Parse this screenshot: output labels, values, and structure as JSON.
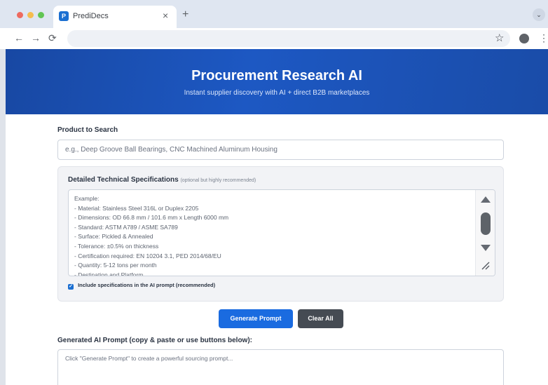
{
  "browser": {
    "tab_title": "PrediDecs",
    "tab_favicon": "P",
    "new_tab": "+",
    "tab_close": "×",
    "tab_menu": "⌄",
    "back": "←",
    "forward": "→",
    "reload": "⟳",
    "bookmark": "☆",
    "menu": "⋮",
    "address": ""
  },
  "hero": {
    "title": "Procurement Research AI",
    "subtitle": "Instant supplier discovery with AI + direct B2B marketplaces"
  },
  "product": {
    "label": "Product to Search",
    "placeholder": "e.g., Deep Groove Ball Bearings, CNC Machined Aluminum Housing"
  },
  "specs": {
    "title": "Detailed Technical Specifications",
    "hint": "(optional but highly recommended)",
    "lines": [
      "Example:",
      "- Material: Stainless Steel 316L or Duplex 2205",
      "- Dimensions: OD 66.8 mm / 101.6 mm x Length 6000 mm",
      "- Standard: ASTM A789 / ASME SA789",
      "- Surface: Pickled & Annealed",
      "- Tolerance: ±0.5% on thickness",
      "- Certification required: EN 10204 3.1, PED 2014/68/EU",
      "- Quantity: 5-12 tons per month",
      "- Destination and Platform..."
    ],
    "include_label": "Include specifications in the AI prompt (recommended)"
  },
  "actions": {
    "generate": "Generate Prompt",
    "clear": "Clear All"
  },
  "output": {
    "label": "Generated AI Prompt (copy & paste or use buttons below):",
    "placeholder": "Click \"Generate Prompt\" to create a powerful sourcing prompt..."
  },
  "colors": {
    "hero_blue": "#1d58c3",
    "primary_button": "#1a6be0",
    "secondary_button": "#454b53"
  }
}
